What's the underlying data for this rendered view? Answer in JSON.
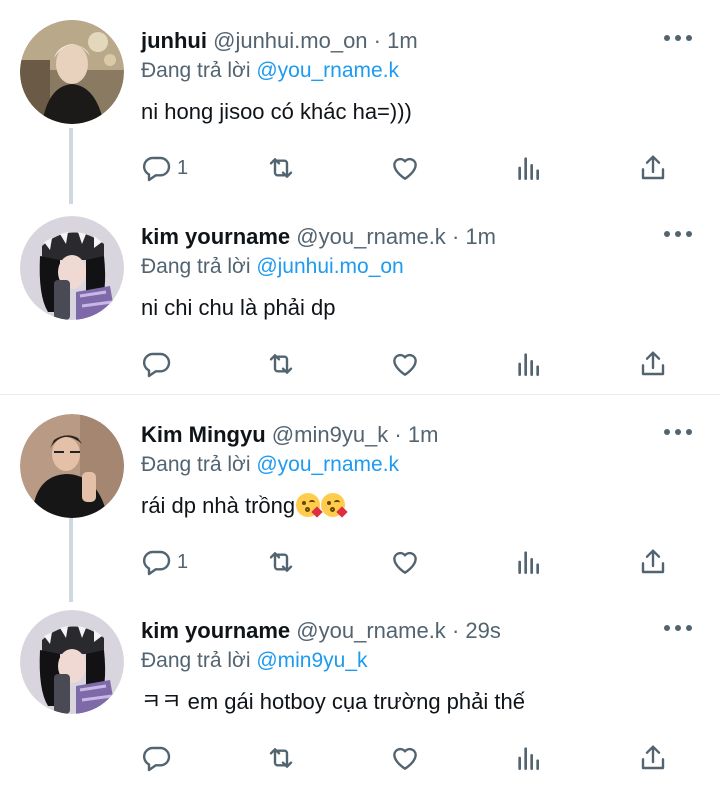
{
  "tweets": [
    {
      "name": "junhui",
      "handle": "@junhui.mo_on",
      "dot": "·",
      "time": "1m",
      "reply_prefix": "Đang trả lời",
      "reply_to": "@you_rname.k",
      "text": "ni hong jisoo có khác ha=)))",
      "reply_count": "1",
      "avatar": "avatar-junhui"
    },
    {
      "name": "kim yourname",
      "handle": "@you_rname.k",
      "dot": "·",
      "time": "1m",
      "reply_prefix": "Đang trả lời",
      "reply_to": "@junhui.mo_on",
      "text": "ni chi chu là phải dp",
      "reply_count": "",
      "avatar": "avatar-yourname"
    },
    {
      "name": "Kim Mingyu",
      "handle": "@min9yu_k",
      "dot": "·",
      "time": "1m",
      "reply_prefix": "Đang trả lời",
      "reply_to": "@you_rname.k",
      "text": "rái dp nhà trồng",
      "reply_count": "1",
      "avatar": "avatar-mingyu"
    },
    {
      "name": "kim yourname",
      "handle": "@you_rname.k",
      "dot": "·",
      "time": "29s",
      "reply_prefix": "Đang trả lời",
      "reply_to": "@min9yu_k",
      "text": "ㅋㅋ em gái hotboy cụa trường phải thế",
      "reply_count": "",
      "avatar": "avatar-yourname"
    }
  ],
  "icons": {
    "reply": "reply-icon",
    "retweet": "retweet-icon",
    "like": "heart-icon",
    "views": "analytics-icon",
    "share": "share-icon",
    "more": "more-options-icon"
  },
  "colors": {
    "link": "#1d9bf0",
    "secondary": "#536471",
    "primary_text": "#0f1419",
    "connector": "#cfd9de",
    "separator": "#e6ecf0"
  }
}
